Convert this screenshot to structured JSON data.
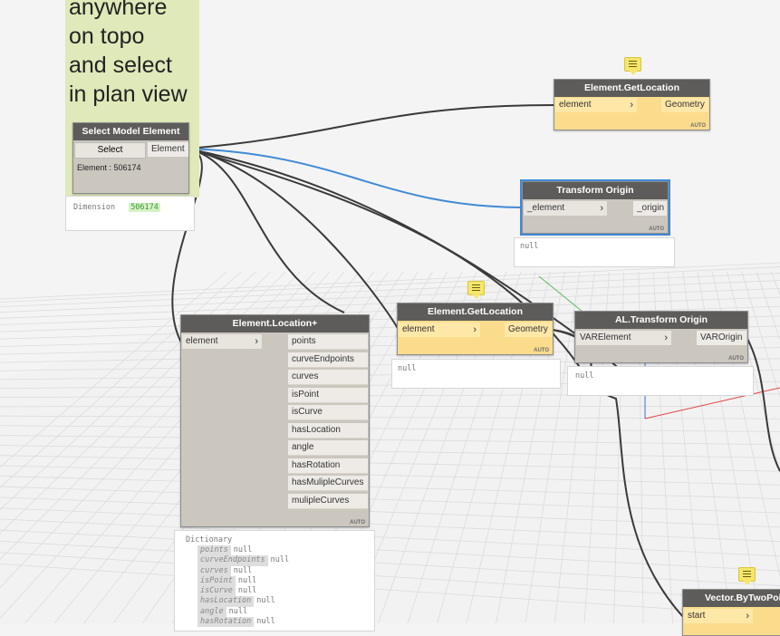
{
  "note": {
    "lines": [
      "anywhere",
      "on topo",
      "and select",
      "in plan view"
    ]
  },
  "select_node": {
    "title": "Select Model Element",
    "button": "Select",
    "output": "Element",
    "value": "Element : 506174",
    "preview_label": "Dimension",
    "preview_value": "506174"
  },
  "get_location_top": {
    "title": "Element.GetLocation",
    "input": "element",
    "output": "Geometry",
    "auto": "AUTO"
  },
  "transform_origin": {
    "title": "Transform Origin",
    "input": "_element",
    "output": "_origin",
    "auto": "AUTO",
    "preview": "null"
  },
  "location_plus": {
    "title": "Element.Location+",
    "input": "element",
    "outputs": [
      "points",
      "curveEndpoints",
      "curves",
      "isPoint",
      "isCurve",
      "hasLocation",
      "angle",
      "hasRotation",
      "hasMulipleCurves",
      "mulipleCurves"
    ],
    "auto": "AUTO"
  },
  "get_location_mid": {
    "title": "Element.GetLocation",
    "input": "element",
    "output": "Geometry",
    "auto": "AUTO",
    "preview": "null"
  },
  "al_transform": {
    "title": "AL.Transform Origin",
    "input": "VARElement",
    "output": "VAROrigin",
    "auto": "AUTO",
    "preview": "null"
  },
  "dictionary": {
    "title": "Dictionary",
    "entries": [
      {
        "key": "points",
        "value": "null"
      },
      {
        "key": "curveEndpoints",
        "value": "null"
      },
      {
        "key": "curves",
        "value": "null"
      },
      {
        "key": "isPoint",
        "value": "null"
      },
      {
        "key": "isCurve",
        "value": "null"
      },
      {
        "key": "hasLocation",
        "value": "null"
      },
      {
        "key": "angle",
        "value": "null"
      },
      {
        "key": "hasRotation",
        "value": "null"
      }
    ]
  },
  "vector_node": {
    "title": "Vector.ByTwoPoin",
    "input": "start"
  }
}
